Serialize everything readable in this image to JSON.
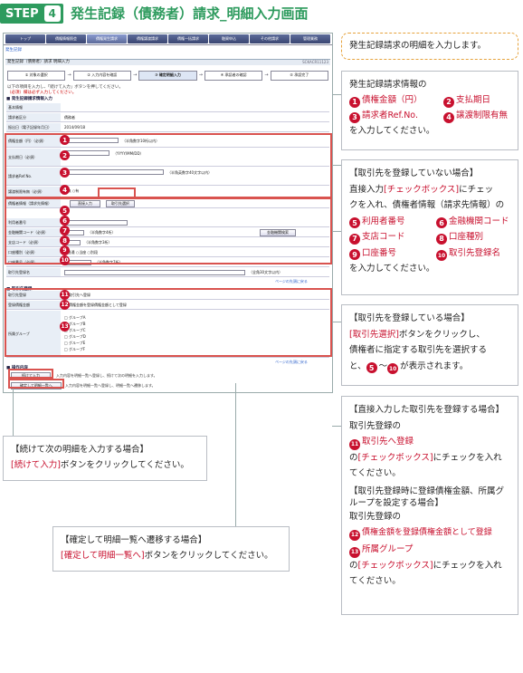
{
  "header": {
    "step_label": "STEP",
    "step_num": "4",
    "title": "発生記録（債務者）請求_明細入力画面"
  },
  "screen": {
    "nav_tabs": [
      "トップ",
      "債権情報照会",
      "債権発生請求",
      "債権譲渡請求",
      "債権一括請求",
      "融資申込",
      "その他請求",
      "管理業務"
    ],
    "active_tab": 2,
    "crumb": "発生記録",
    "bar_title": "発生記録（債務者）請求 明細入力",
    "bar_code": "SCKACR11123",
    "steps": [
      "① 対象の選択",
      "② 入力内容を確認",
      "③ 確定明細入力",
      "④ 承認者の確認",
      "⑤ 承認完了"
    ],
    "note1": "以下の項目を入力し、「続けて入力」ボタンを押してください。",
    "note2": "（必須）欄は必ず入力してください。",
    "sec_basic": "■ 発生記録請求情報入力",
    "sec_basic2": "基本情報",
    "rows_basic": [
      {
        "label": "請求者区分",
        "value": "債務者"
      },
      {
        "label": "振出日（電子記録年月日）",
        "value": "2014/09/18"
      }
    ],
    "rows_info": [
      {
        "label": "債権金額（円）（必須）",
        "value": "（半角数字10桁以内）"
      },
      {
        "label": "支払期日（必須）",
        "value": "（YYYY/MM/DD）"
      },
      {
        "label": "請求者Ref.No.",
        "value": "（半角英数字40文字以内）"
      },
      {
        "label": "譲渡制限有無（必須）",
        "value": "○無  ○有"
      }
    ],
    "rows_partner": [
      {
        "label": "債権者情報（請求先情報）",
        "value": "取引先選択"
      },
      {
        "label": "利用者番号",
        "value": ""
      },
      {
        "label": "金融機関コード（必須）",
        "value": "（半角数字4桁）"
      },
      {
        "label": "支店コード（必須）",
        "value": "（半角数字3桁）"
      },
      {
        "label": "口座種別（必須）",
        "value": "○普通  ○当座  ○別段"
      },
      {
        "label": "口座番号（必須）",
        "value": "（半角数字7桁）"
      },
      {
        "label": "取引先登録名",
        "value": "（全角30文字以内）"
      }
    ],
    "btn_select": "取引先選択",
    "btn_direct": "直接入力",
    "btn_bank": "金融機関検索",
    "sec_register": "■ 取引先登録",
    "rows_register": [
      {
        "label": "取引先登録",
        "value": "□ 取引先へ登録"
      },
      {
        "label": "登録債権金額",
        "value": "□ 債権金額を登録債権金額として登録"
      },
      {
        "label": "所属グループ",
        "value": "□ グループA\n□ グループB\n□ グループC\n□ グループD\n□ グループE\n□ グループF"
      }
    ],
    "sec_op": "■ 操作内容",
    "btn_continue": "続けて入力",
    "btn_confirm": "確定して明細一覧へ",
    "op_note1": "入力内容を明細一覧へ登録し、続けて次の明細を入力します。",
    "op_note2": "入力内容を明細一覧へ登録し、明細一覧へ遷移します。",
    "pagetop": "ページの先頭に戻る"
  },
  "callouts": {
    "c1": "発生記録請求の明細を入力します。",
    "c2_title": "発生記録請求情報の",
    "c2_items": [
      {
        "n": "1",
        "t": "債権金額（円）"
      },
      {
        "n": "2",
        "t": "支払期日"
      },
      {
        "n": "3",
        "t": "請求者Ref.No."
      },
      {
        "n": "4",
        "t": "譲渡制限有無"
      }
    ],
    "c2_end": "を入力してください。",
    "c3_head": "【取引先を登録していない場合】",
    "c3_l1a": "直接入力",
    "c3_l1b": "[チェックボックス]",
    "c3_l1c": "にチェッ",
    "c3_l2": "クを入れ、債権者情報（請求先情報）の",
    "c3_items": [
      {
        "n": "5",
        "t": "利用者番号"
      },
      {
        "n": "6",
        "t": "金融機関コード"
      },
      {
        "n": "7",
        "t": "支店コード"
      },
      {
        "n": "8",
        "t": "口座種別"
      },
      {
        "n": "9",
        "t": "口座番号"
      },
      {
        "n": "10",
        "t": "取引先登録名"
      }
    ],
    "c3_end": "を入力してください。",
    "c4_head": "【取引先を登録している場合】",
    "c4_l1a": "[取引先選択]",
    "c4_l1b": "ボタンをクリックし、",
    "c4_l2": "債権者に指定する取引先を選択する",
    "c4_l3a": "と、",
    "c4_n1": "5",
    "c4_l3b": "〜",
    "c4_n2": "10",
    "c4_l3c": "が表示されます。",
    "c5_head": "【直接入力した取引先を登録する場合】",
    "c5_l1": "取引先登録の",
    "c5_n1": "11",
    "c5_t1": "取引先へ登録",
    "c5_l2a": "の",
    "c5_l2b": "[チェックボックス]",
    "c5_l2c": "にチェックを入れ",
    "c5_l3": "てください。",
    "c5_head2": "【取引先登録時に登録債権金額、所属グループを設定する場合】",
    "c5_l4": "取引先登録の",
    "c5_n2": "12",
    "c5_t2": "債権金額を登録債権金額として登録",
    "c5_n3": "13",
    "c5_t3": "所属グループ",
    "c5_l5a": "の",
    "c5_l5b": "[チェックボックス]",
    "c5_l5c": "にチェックを入れ",
    "c5_l6": "てください。",
    "c6_head": "【続けて次の明細を入力する場合】",
    "c6_a": "[続けて入力]",
    "c6_b": "ボタンをクリックしてください。",
    "c7_head": "【確定して明細一覧へ遷移する場合】",
    "c7_a": "[確定して明細一覧へ]",
    "c7_b": "ボタンをクリックしてください。"
  },
  "markers": [
    "1",
    "2",
    "3",
    "4",
    "5",
    "6",
    "7",
    "8",
    "9",
    "10",
    "11",
    "12",
    "13"
  ],
  "colors": {
    "accent": "#2e9b5e",
    "marker": "#c8102e",
    "highlight": "#d9534f"
  }
}
